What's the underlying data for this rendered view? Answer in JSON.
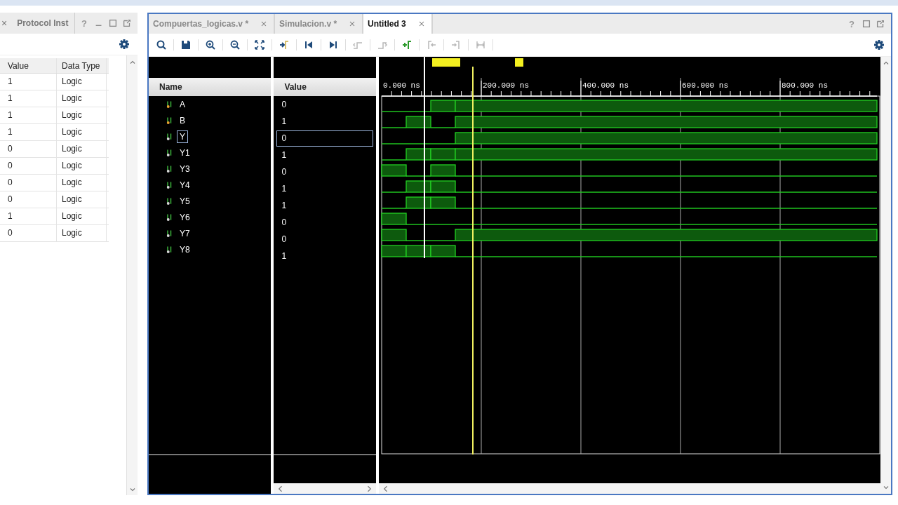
{
  "side_panel": {
    "cut_close": "×",
    "tab": "Protocol Inst",
    "help": "?",
    "table": {
      "columns": [
        "Value",
        "Data Type"
      ],
      "rows": [
        [
          "1",
          "Logic"
        ],
        [
          "1",
          "Logic"
        ],
        [
          "1",
          "Logic"
        ],
        [
          "1",
          "Logic"
        ],
        [
          "0",
          "Logic"
        ],
        [
          "0",
          "Logic"
        ],
        [
          "0",
          "Logic"
        ],
        [
          "0",
          "Logic"
        ],
        [
          "1",
          "Logic"
        ],
        [
          "0",
          "Logic"
        ]
      ]
    }
  },
  "editor": {
    "tabs": [
      {
        "label": "Compuertas_logicas.v *",
        "selected": false
      },
      {
        "label": "Simulacion.v *",
        "selected": false
      },
      {
        "label": "Untitled 3",
        "selected": true
      }
    ],
    "help": "?",
    "toolbar": [
      {
        "kind": "search",
        "disabled": false
      },
      {
        "kind": "save",
        "disabled": false
      },
      {
        "kind": "zoom-in",
        "disabled": false
      },
      {
        "kind": "zoom-out",
        "disabled": false
      },
      {
        "kind": "fit",
        "disabled": false
      },
      {
        "kind": "to-cursor",
        "disabled": false
      },
      {
        "kind": "go-start",
        "disabled": false
      },
      {
        "kind": "go-end",
        "disabled": false
      },
      {
        "kind": "prev-edge",
        "disabled": true
      },
      {
        "kind": "next-edge",
        "disabled": true
      },
      {
        "kind": "add-marker",
        "disabled": false
      },
      {
        "kind": "prev-marker",
        "disabled": true
      },
      {
        "kind": "next-marker",
        "disabled": true
      },
      {
        "kind": "marker-span",
        "disabled": true
      }
    ],
    "wave_viewer": {
      "name_header": "Name",
      "value_header": "Value",
      "time_labels": [
        "0.000 ns",
        "200.000 ns",
        "400.000 ns",
        "600.000 ns",
        "800.000 ns"
      ],
      "signals": [
        {
          "name": "A",
          "kind": "input",
          "value": "0",
          "selected": false,
          "high": [
            false,
            false,
            true,
            true
          ]
        },
        {
          "name": "B",
          "kind": "input",
          "value": "1",
          "selected": false,
          "high": [
            false,
            true,
            false,
            true
          ]
        },
        {
          "name": "Y",
          "kind": "output",
          "value": "0",
          "selected": true,
          "high": [
            false,
            false,
            false,
            true
          ]
        },
        {
          "name": "Y1",
          "kind": "output",
          "value": "1",
          "selected": false,
          "high": [
            false,
            true,
            true,
            true
          ]
        },
        {
          "name": "Y3",
          "kind": "output",
          "value": "0",
          "selected": false,
          "high": [
            true,
            false,
            true,
            false
          ]
        },
        {
          "name": "Y4",
          "kind": "output",
          "value": "1",
          "selected": false,
          "high": [
            false,
            true,
            true,
            false
          ]
        },
        {
          "name": "Y5",
          "kind": "output",
          "value": "1",
          "selected": false,
          "high": [
            false,
            true,
            true,
            false
          ]
        },
        {
          "name": "Y6",
          "kind": "output",
          "value": "0",
          "selected": false,
          "high": [
            true,
            false,
            false,
            false
          ]
        },
        {
          "name": "Y7",
          "kind": "output",
          "value": "0",
          "selected": false,
          "high": [
            true,
            false,
            false,
            true
          ]
        },
        {
          "name": "Y8",
          "kind": "output",
          "value": "1",
          "selected": false,
          "high": [
            true,
            true,
            true,
            false
          ]
        }
      ]
    }
  }
}
